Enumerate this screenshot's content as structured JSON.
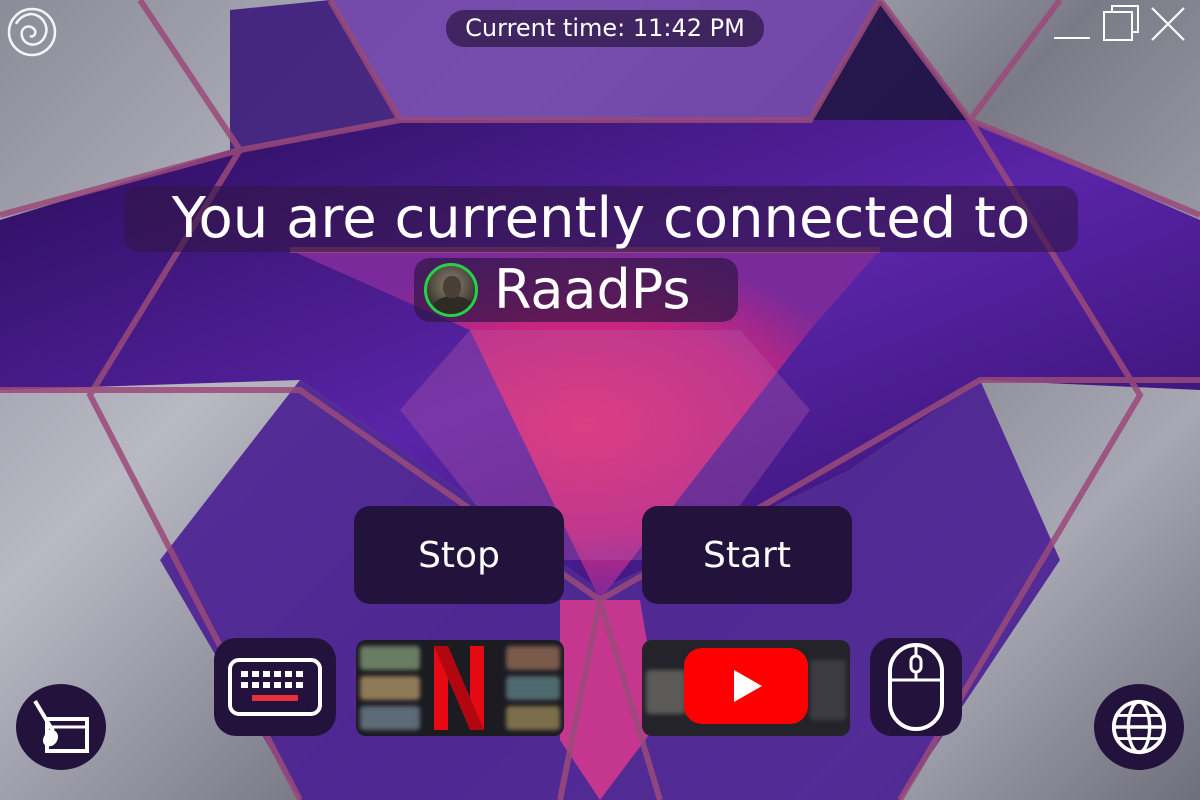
{
  "header": {
    "clock_text": "Current time: 11:42 PM",
    "logo_icon": "swirl-logo-icon",
    "window_controls": {
      "minimize_icon": "minimize-icon",
      "maximize_icon": "maximize-icon",
      "close_icon": "close-icon"
    }
  },
  "connection": {
    "headline": "You are currently connected to",
    "peer_name": "RaadPs",
    "peer_status_color": "#22d34a",
    "avatar_icon": "user-avatar"
  },
  "controls": {
    "stop_label": "Stop",
    "start_label": "Start"
  },
  "dock": {
    "keyboard_icon": "keyboard-icon",
    "netflix_icon": "netflix-logo-icon",
    "youtube_icon": "youtube-logo-icon",
    "mouse_icon": "mouse-icon",
    "draw_icon": "paintbrush-canvas-icon",
    "globe_icon": "globe-icon"
  },
  "colors": {
    "accent_purple": "#3a1470",
    "accent_pink": "#e8307a",
    "button_bg": "#23123c",
    "netflix_red": "#e50914",
    "youtube_red": "#ff0000"
  }
}
